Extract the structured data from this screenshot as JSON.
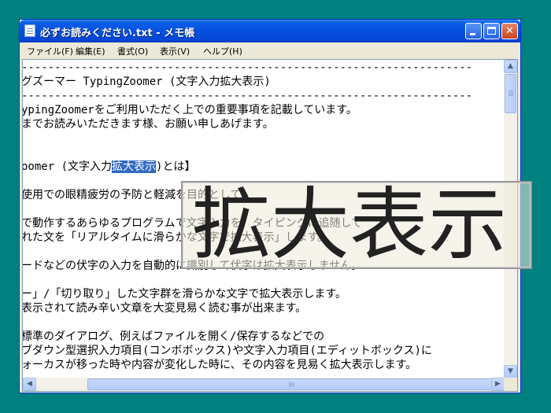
{
  "window": {
    "title": "必ずお読みください.txt - メモ帳",
    "buttons": {
      "minimize": "",
      "maximize": "",
      "close": "✕"
    }
  },
  "menu": [
    "ファイル(F)",
    "編集(E)",
    "書式(O)",
    "表示(V)",
    "ヘルプ(H)"
  ],
  "document": {
    "lines": [
      "--------------------------------------------------------------------",
      "グズーマー TypingZoomer (文字入力拡大表示)",
      "--------------------------------------------------------------------",
      "ypingZoomerをご利用いただく上での重要事項を記載しています。",
      "までお読みいただきます様、お願い申しあげます。",
      "",
      "",
      "",
      "",
      "使用での眼精疲労の予防と軽減を目的として、",
      "",
      "で動作するあらゆるプログラムで文字入力を、タイピングに追随して",
      "れた文を「リアルタイムに滑らかな文字で拡大表示」します。",
      "",
      "ードなどの伏字の入力を自動的に識別して伏字は拡大表示しません。",
      "",
      "ー」/「切り取り」した文字群を滑らかな文字で拡大表示します。",
      "表示されて読み辛い文章を大変見易く読む事が出来ます。",
      "",
      "標準のダイアログ、例えばファイルを開く/保存するなどでの",
      "ブダウン型選択入力項目(コンボボックス)や文字入力項目(エディットボックス)に",
      "ォーカスが移った時や内容が変化した時に、その内容を見易く拡大表示します。"
    ],
    "heading_line": {
      "before": "oomer (文字入力",
      "selected": "拡大表示",
      "after": ")とは】"
    }
  },
  "zoom_popup": {
    "text": "拡大表示"
  },
  "scrollbars": {
    "up": "▲",
    "down": "▼",
    "left": "◀",
    "right": "▶"
  }
}
